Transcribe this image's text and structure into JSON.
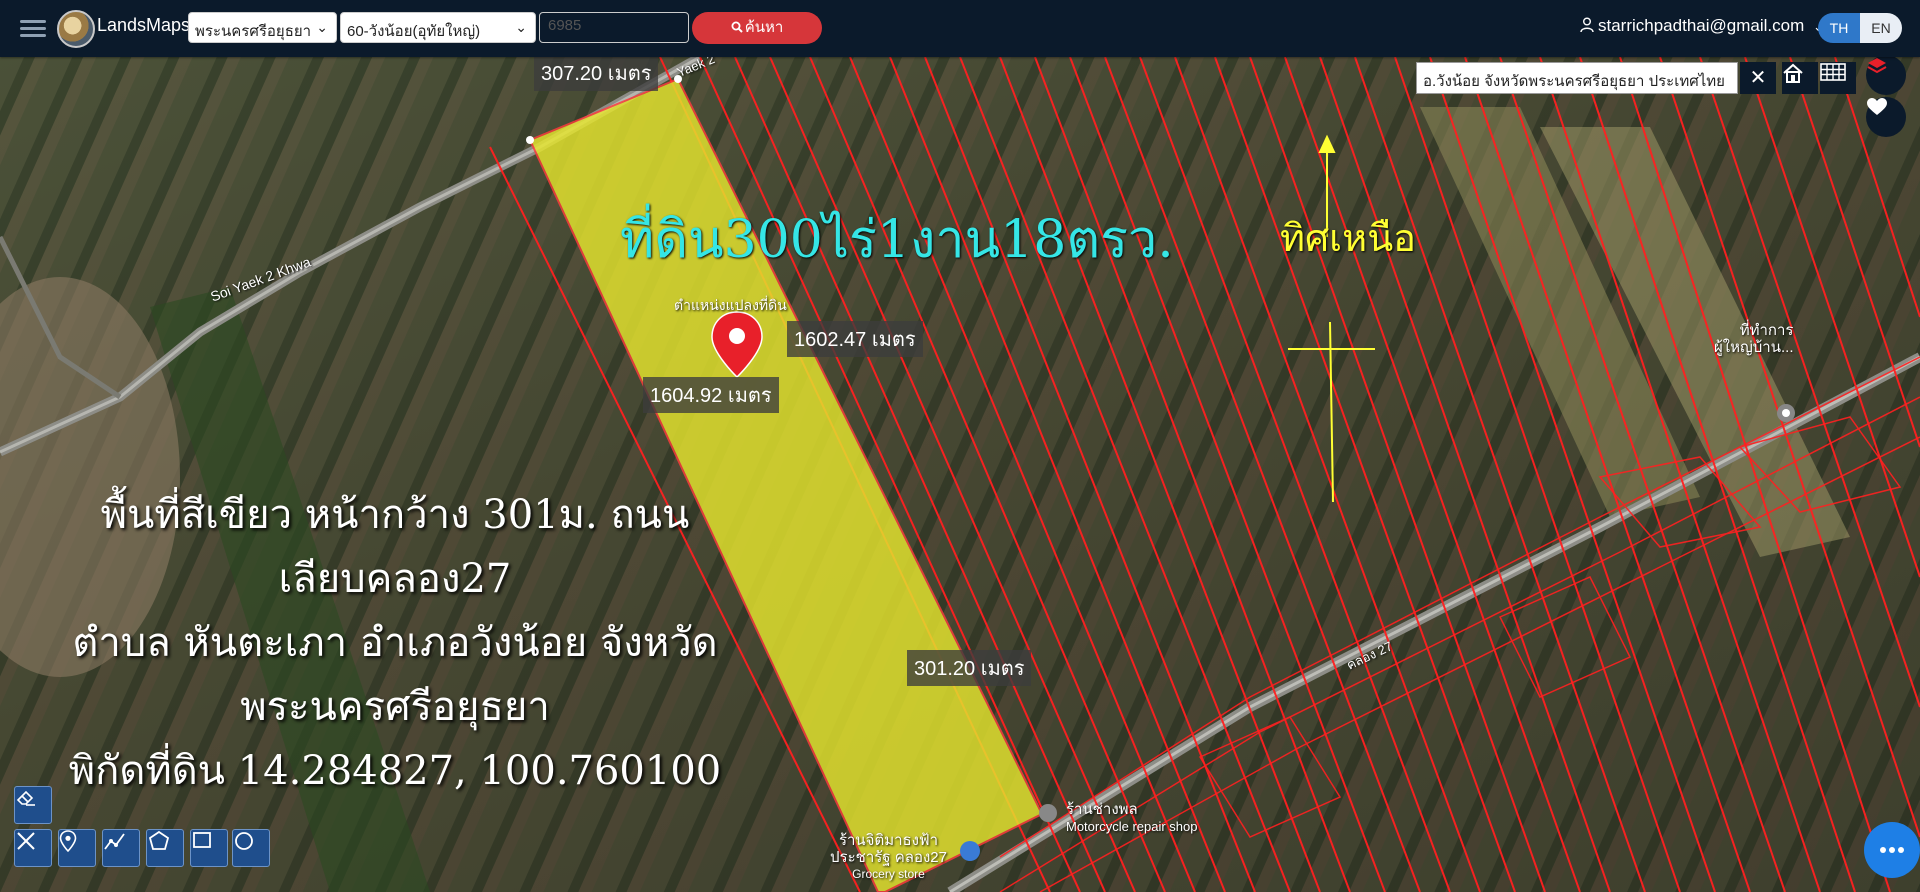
{
  "app": {
    "brand": "LandsMaps"
  },
  "toolbar": {
    "province": "พระนครศรีอยุธยา",
    "district": "60-วังน้อย(อุทัยใหญ่)",
    "parcel_number": "6985",
    "search_label": "ค้นหา"
  },
  "user": {
    "email": "starrichpadthai@gmail.com"
  },
  "language": {
    "th": "TH",
    "en": "EN",
    "active": "TH"
  },
  "map": {
    "location_text": "อ.วังน้อย จังหวัดพระนครศรีอยุธยา ประเทศไทย",
    "close_symbol": "✕",
    "measurements": {
      "top": "307.20 เมตร",
      "right_side": "1602.47 เมตร",
      "left_side": "1604.92 เมตร",
      "bottom": "301.20 เมตร"
    },
    "title_text": "ที่ดิน300ไร่1งาน18ตรว.",
    "north_label": "ทิศเหนือ",
    "pin_label": "ตำแหน่งแปลงที่ดิน",
    "info_lines": [
      "พื้นที่สีเขียว หน้ากว้าง 301ม. ถนน เลียบคลอง27",
      "ตำบล หันตะเภา อำเภอวังน้อย จังหวัดพระนครศรีอยุธยา",
      "พิกัดที่ดิน 14.284827, 100.760100"
    ],
    "road_label_1": "Soi Yaek 2 Khwa",
    "road_label_2": "Yaek 2",
    "road_label_3": "คลอง 27",
    "places": {
      "village_office_line1": "ที่ทำการ",
      "village_office_line2": "ผู้ใหญ่บ้าน...",
      "motor_shop_th": "ร้านช่างพล",
      "motor_shop_en": "Motorcycle repair shop",
      "grocery_line1": "ร้านจิติมาธงฟ้า",
      "grocery_line2": "ประชารัฐ คลอง27",
      "grocery_line3": "Grocery store"
    },
    "colors": {
      "parcel_fill": "#e6e62e",
      "parcel_lines": "#ff2020",
      "pin": "#e8202a",
      "title_text": "#35e6e6",
      "north_text": "#ffff33"
    }
  }
}
